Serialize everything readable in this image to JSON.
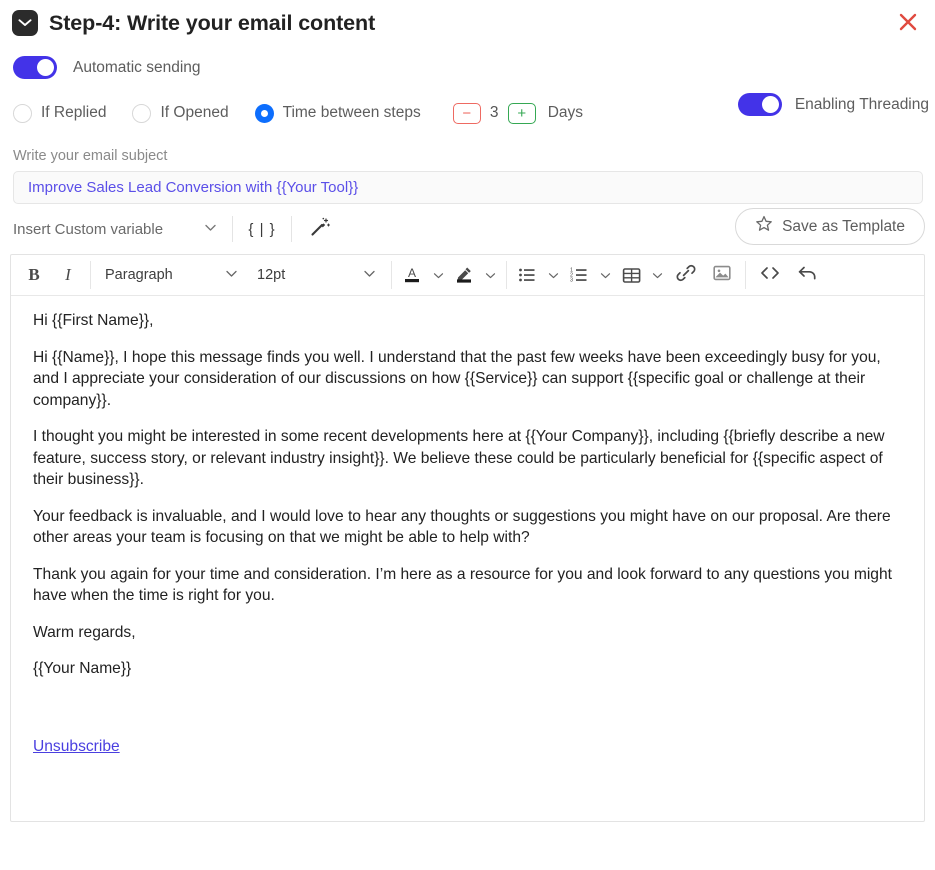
{
  "header": {
    "icon": "mail-icon",
    "title": "Step-4:  Write your email content",
    "close_icon": "close-icon"
  },
  "automatic_sending": {
    "label": "Automatic sending",
    "enabled": true,
    "toggle_color": "#4333E8"
  },
  "options": {
    "radios": [
      {
        "label": "If Replied",
        "selected": false
      },
      {
        "label": "If Opened",
        "selected": false
      },
      {
        "label": "Time between steps",
        "selected": true
      }
    ],
    "selected_color": "#0D6EFD",
    "stepper": {
      "minus_label": "−",
      "value": "3",
      "plus_label": "+",
      "unit": "Days",
      "minus_color": "#EE6A62",
      "plus_color": "#35A853"
    },
    "threading": {
      "label": "Enabling Threading",
      "enabled": true,
      "toggle_color": "#4333E8"
    }
  },
  "subject": {
    "label": "Write your email subject",
    "value": "Improve Sales Lead Conversion with {{Your Tool}}",
    "placeholder": "Write your email subject",
    "text_color": "#5B4FE8"
  },
  "variable_bar": {
    "insert_variable_label": "Insert Custom variable",
    "chevron_icon": "chevron-down-icon",
    "brace_label": "{ | }",
    "wand_icon": "magic-wand-icon",
    "save_template_label": "Save as Template",
    "star_icon": "star-icon"
  },
  "format_toolbar": {
    "bold_label": "B",
    "italic_label": "I",
    "paragraph_label": "Paragraph",
    "font_size_label": "12pt",
    "text_color_icon": "text-color-icon",
    "highlight_icon": "highlight-color-icon",
    "bullet_list_icon": "bullet-list-icon",
    "numbered_list_icon": "numbered-list-icon",
    "table_icon": "table-icon",
    "link_icon": "link-icon",
    "image_icon": "image-icon",
    "code_icon": "code-icon",
    "undo_icon": "undo-icon"
  },
  "email_body": {
    "paragraphs": [
      "Hi {{First Name}},",
      "Hi {{Name}}, I hope this message finds you well. I understand that the past few weeks have been exceedingly busy for you, and I appreciate your consideration of our discussions on how {{Service}} can support {{specific goal or challenge at their company}}.",
      "I thought you might be interested in some recent developments here at {{Your Company}}, including {{briefly describe a new feature, success story, or relevant industry insight}}. We believe these could be particularly beneficial for {{specific aspect of their business}}.",
      "Your feedback is invaluable, and I would love to hear any thoughts or suggestions you might have on our proposal. Are there other areas your team is focusing on that we might be able to help with?",
      "Thank you again for your time and consideration. I’m here as a resource for you and look forward to any questions you might have when the time is right for you.",
      "Warm regards,",
      "{{Your Name}}"
    ],
    "unsubscribe_label": "Unsubscribe",
    "unsubscribe_color": "#4a3FE0"
  }
}
